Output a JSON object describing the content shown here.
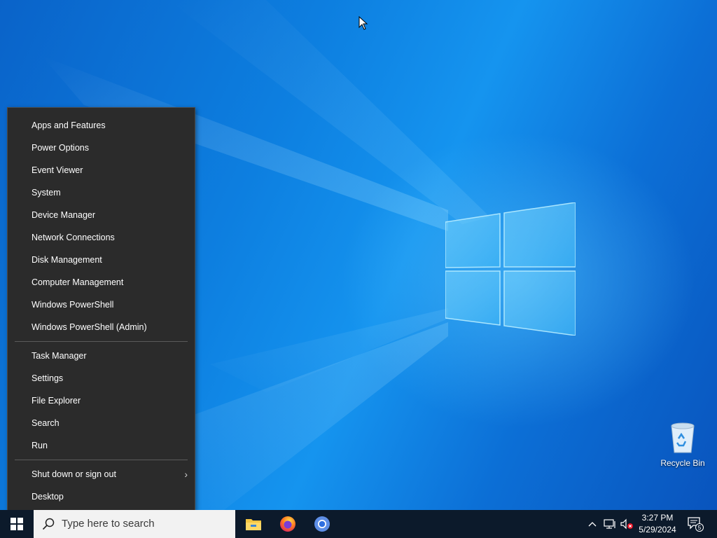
{
  "context_menu": {
    "group1": [
      {
        "label": "Apps and Features"
      },
      {
        "label": "Power Options"
      },
      {
        "label": "Event Viewer"
      },
      {
        "label": "System"
      },
      {
        "label": "Device Manager"
      },
      {
        "label": "Network Connections"
      },
      {
        "label": "Disk Management"
      },
      {
        "label": "Computer Management"
      },
      {
        "label": "Windows PowerShell"
      },
      {
        "label": "Windows PowerShell (Admin)"
      }
    ],
    "group2": [
      {
        "label": "Task Manager"
      },
      {
        "label": "Settings"
      },
      {
        "label": "File Explorer"
      },
      {
        "label": "Search"
      },
      {
        "label": "Run"
      }
    ],
    "group3": [
      {
        "label": "Shut down or sign out",
        "submenu_icon": "chevron-right-icon"
      },
      {
        "label": "Desktop"
      }
    ]
  },
  "desktop": {
    "icons": [
      {
        "label": "Recycle Bin",
        "icon": "recycle-bin-icon"
      }
    ]
  },
  "taskbar": {
    "start_icon": "windows-start-icon",
    "search": {
      "placeholder": "Type here to search",
      "icon": "search-icon"
    },
    "pinned_apps": [
      {
        "name": "file-explorer",
        "icon": "folder-icon"
      },
      {
        "name": "firefox",
        "icon": "firefox-icon"
      },
      {
        "name": "chromium",
        "icon": "chromium-icon"
      }
    ],
    "tray": {
      "icons": [
        "chevron-up-icon",
        "network-icon",
        "volume-muted-icon"
      ],
      "time": "3:27 PM",
      "date": "5/29/2024",
      "notification_count": "5"
    }
  },
  "colors": {
    "menu_background": "#2b2b2b",
    "taskbar_background": "#0c1a2b",
    "desktop_accent": "#0c78dc"
  }
}
